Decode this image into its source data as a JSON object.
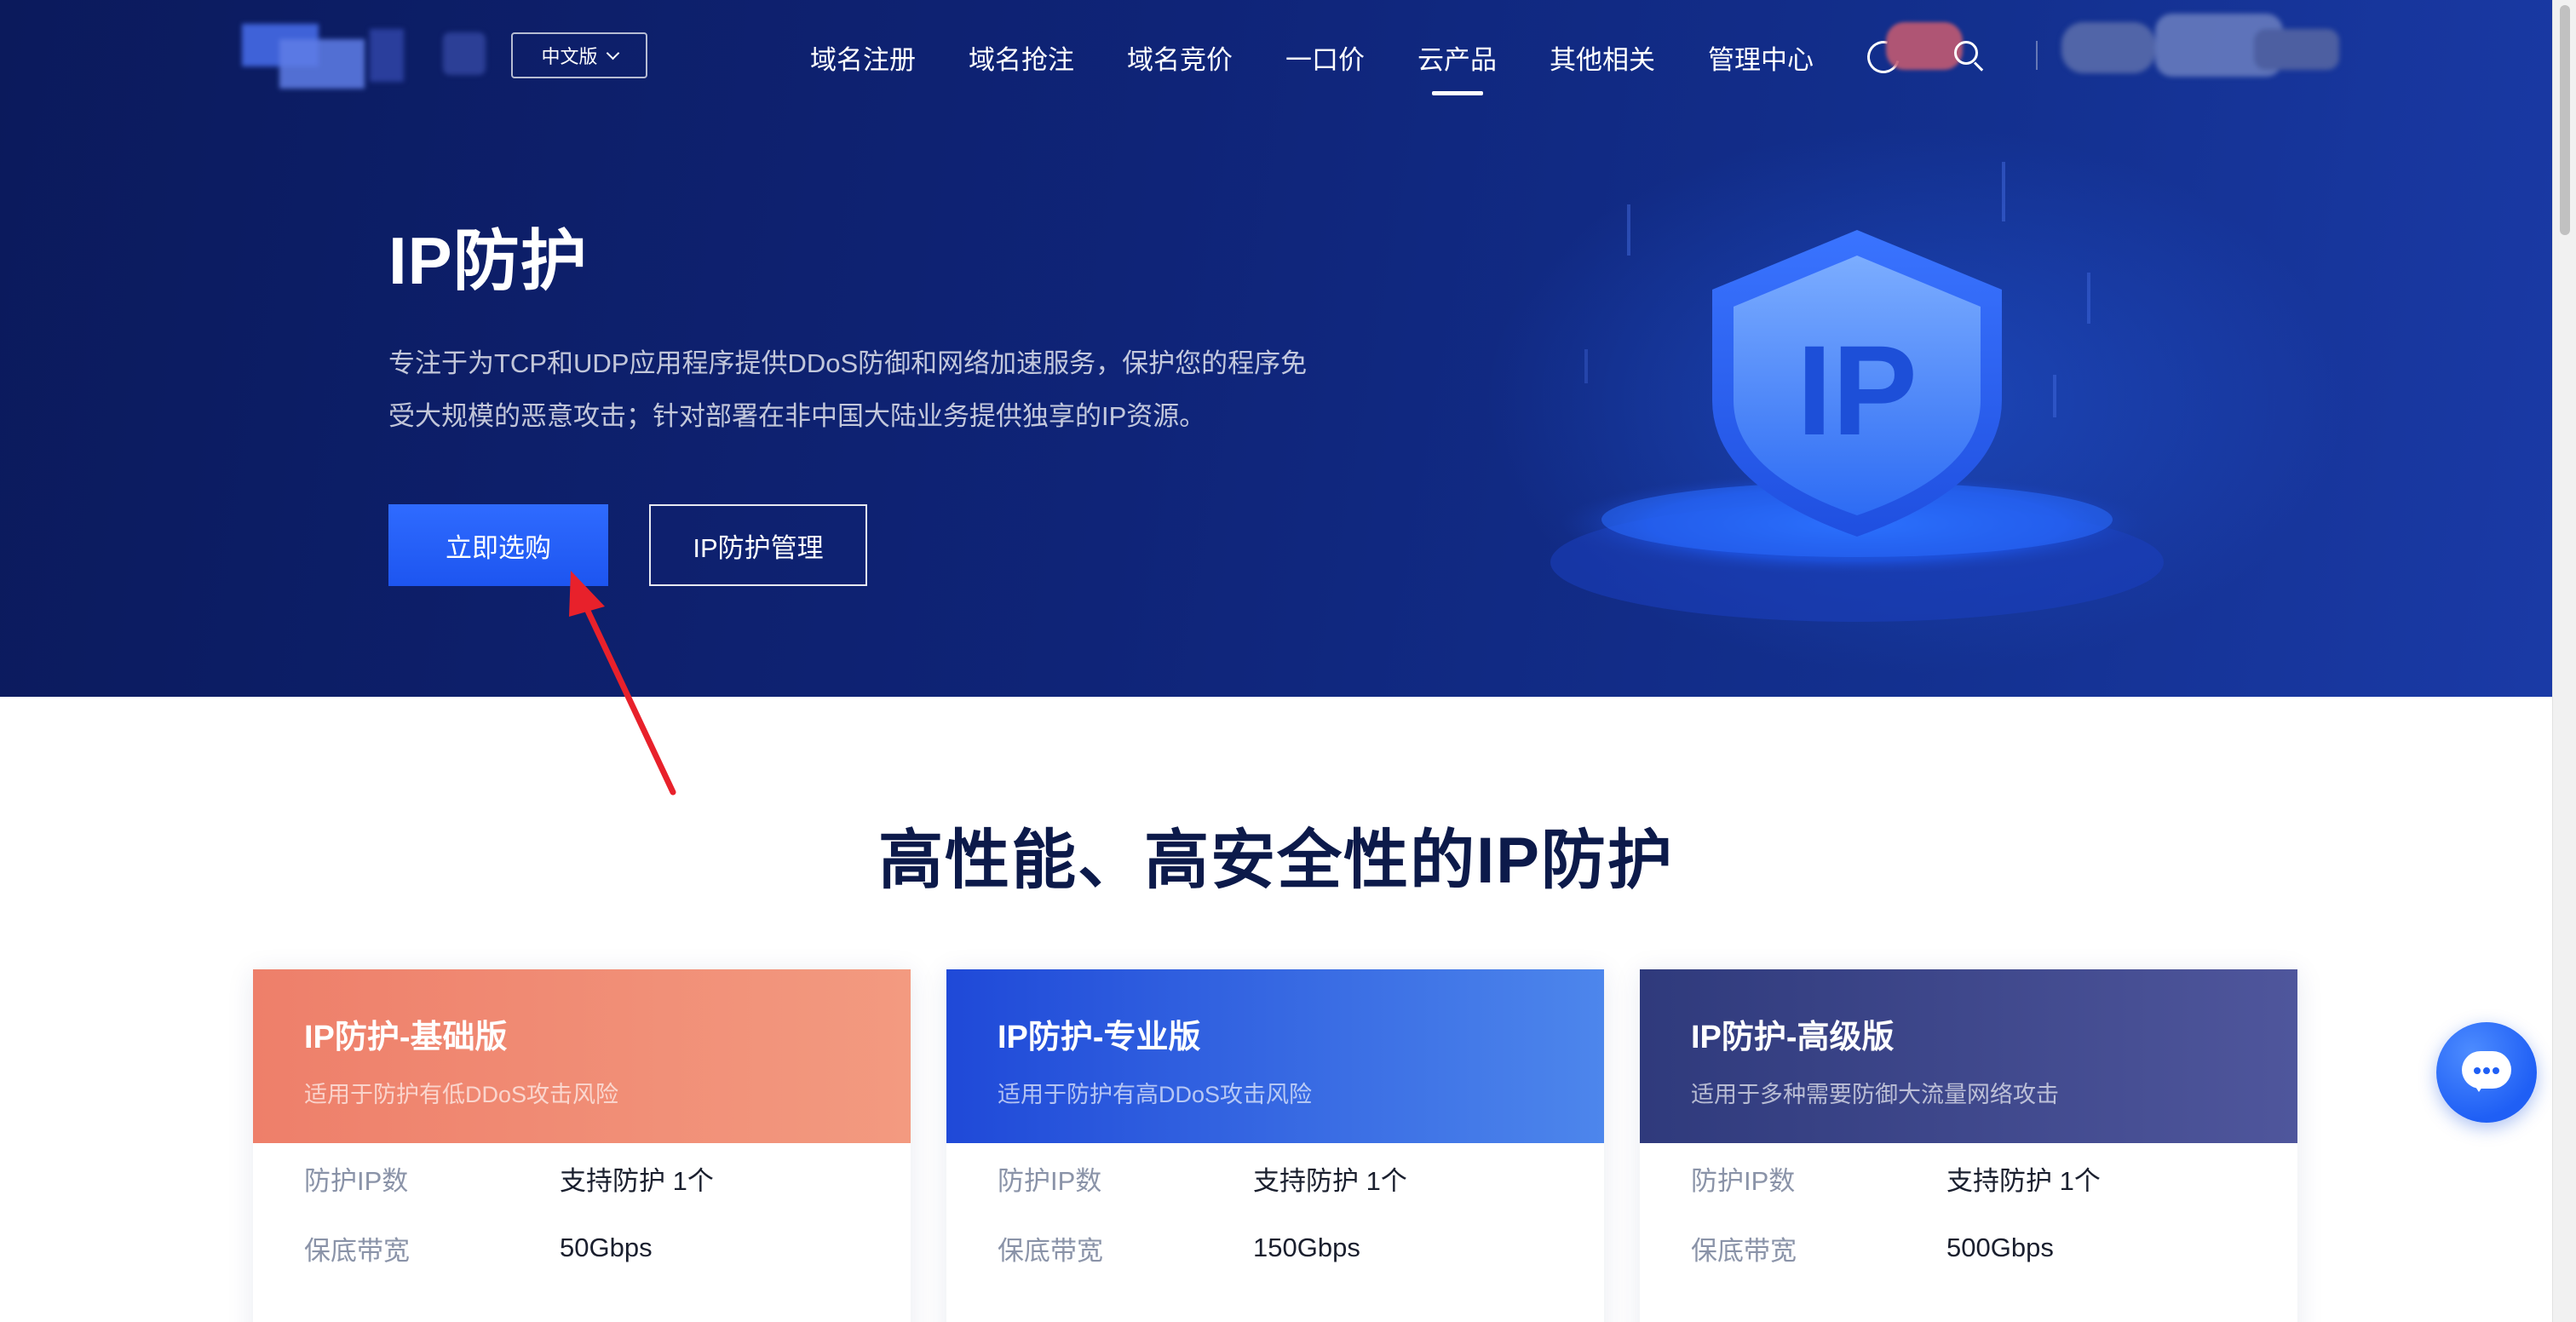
{
  "nav": {
    "lang_label": "中文版",
    "items": [
      {
        "label": "域名注册"
      },
      {
        "label": "域名抢注"
      },
      {
        "label": "域名竞价"
      },
      {
        "label": "一口价"
      },
      {
        "label": "云产品",
        "active": true
      },
      {
        "label": "其他相关"
      },
      {
        "label": "管理中心"
      }
    ]
  },
  "hero": {
    "title": "IP防护",
    "desc_line1": "专注于为TCP和UDP应用程序提供DDoS防御和网络加速服务，保护您的程序免",
    "desc_line2": "受大规模的恶意攻击；针对部署在非中国大陆业务提供独享的IP资源。",
    "primary_button": "立即选购",
    "secondary_button": "IP防护管理",
    "shield_text": "IP"
  },
  "section": {
    "title": "高性能、高安全性的IP防护"
  },
  "plans": [
    {
      "name": "IP防护-基础版",
      "subtitle": "适用于防护有低DDoS攻击风险",
      "rows": [
        {
          "label": "防护IP数",
          "value": "支持防护 1个"
        },
        {
          "label": "保底带宽",
          "value": "50Gbps"
        }
      ]
    },
    {
      "name": "IP防护-专业版",
      "subtitle": "适用于防护有高DDoS攻击风险",
      "rows": [
        {
          "label": "防护IP数",
          "value": "支持防护 1个"
        },
        {
          "label": "保底带宽",
          "value": "150Gbps"
        }
      ]
    },
    {
      "name": "IP防护-高级版",
      "subtitle": "适用于多种需要防御大流量网络攻击",
      "rows": [
        {
          "label": "防护IP数",
          "value": "支持防护 1个"
        },
        {
          "label": "保底带宽",
          "value": "500Gbps"
        }
      ]
    }
  ],
  "colors": {
    "hero_bg": "#0f2478",
    "primary_button": "#1d55f0",
    "plan_basic": "#ee7f6a",
    "plan_pro": "#1f49d8",
    "plan_advanced": "#2f3a7c",
    "annotation_arrow": "#e8212b"
  },
  "icons": {
    "lang_dropdown": "chevron-down-icon",
    "theme": "moon-icon",
    "search": "search-icon",
    "chat": "chat-bubble-icon"
  }
}
